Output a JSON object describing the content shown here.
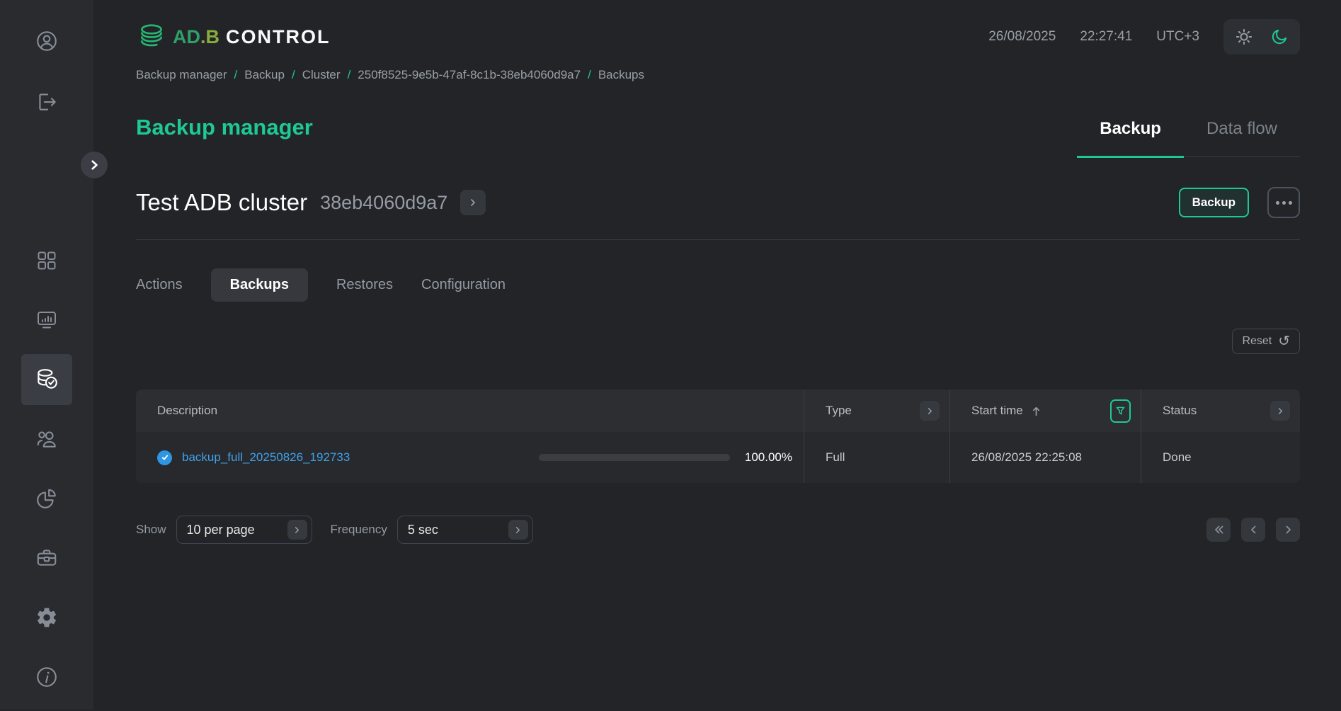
{
  "logo": {
    "brand_primary": "AD",
    "brand_secondary": ".B",
    "brand_suffix": "CONTROL"
  },
  "clock": {
    "date": "26/08/2025",
    "time": "22:27:41",
    "timezone": "UTC+3"
  },
  "breadcrumb": {
    "separator": "/",
    "items": [
      "Backup manager",
      "Backup",
      "Cluster",
      "250f8525-9e5b-47af-8c1b-38eb4060d9a7",
      "Backups"
    ]
  },
  "page": {
    "title": "Backup manager"
  },
  "top_tabs": [
    {
      "label": "Backup",
      "active": true
    },
    {
      "label": "Data flow",
      "active": false
    }
  ],
  "cluster": {
    "name": "Test ADB cluster",
    "id": "38eb4060d9a7",
    "backup_button_label": "Backup"
  },
  "sub_tabs": [
    {
      "label": "Actions",
      "active": false
    },
    {
      "label": "Backups",
      "active": true
    },
    {
      "label": "Restores",
      "active": false
    },
    {
      "label": "Configuration",
      "active": false
    }
  ],
  "toolbar": {
    "reset_label": "Reset"
  },
  "table": {
    "columns": [
      {
        "label": "Description"
      },
      {
        "label": "Type",
        "chevron": true
      },
      {
        "label": "Start time",
        "sort": "asc",
        "filter": true
      },
      {
        "label": "Status",
        "chevron": true
      }
    ],
    "rows": [
      {
        "description": "backup_full_20250826_192733",
        "progress_percent": 100,
        "progress_label": "100.00%",
        "type": "Full",
        "start_time": "26/08/2025 22:25:08",
        "status": "Done"
      }
    ]
  },
  "footer": {
    "show_label": "Show",
    "show_value": "10 per page",
    "frequency_label": "Frequency",
    "frequency_value": "5 sec"
  },
  "sidebar": {
    "items": [
      {
        "icon": "user-circle-icon"
      },
      {
        "icon": "logout-icon"
      },
      {
        "icon": "dashboard-grid-icon"
      },
      {
        "icon": "monitoring-chart-icon"
      },
      {
        "icon": "backup-database-icon",
        "active": true
      },
      {
        "icon": "users-icon"
      },
      {
        "icon": "pie-chart-icon"
      },
      {
        "icon": "briefcase-icon"
      },
      {
        "icon": "settings-gear-icon"
      },
      {
        "icon": "info-icon"
      }
    ]
  },
  "colors": {
    "accent_green": "#1ec895",
    "logo_green": "#2fa06a",
    "logo_olive": "#8aab3d",
    "link_blue": "#41a1e8",
    "progress_blue": "#2e96e2",
    "background": "#222427",
    "sidebar_background": "#292b2f",
    "table_header_background": "#2c2e32",
    "table_row_background": "#27292d"
  }
}
